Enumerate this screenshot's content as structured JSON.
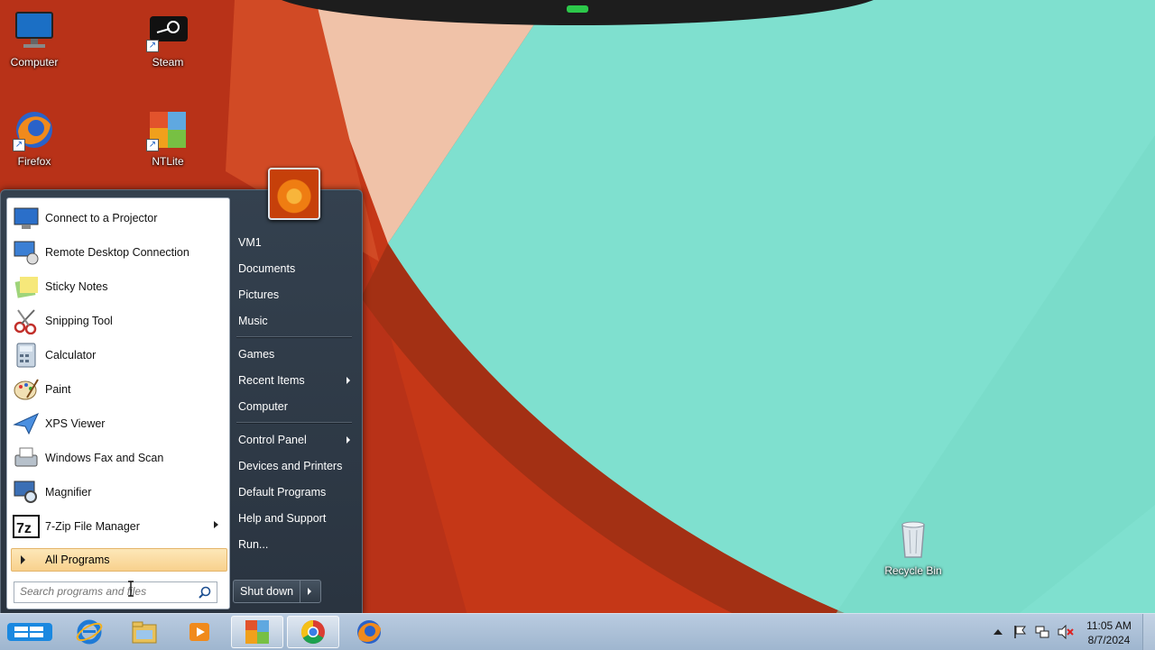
{
  "desktop": {
    "icons": [
      {
        "label": "Computer"
      },
      {
        "label": "Steam"
      },
      {
        "label": "Firefox"
      },
      {
        "label": "NTLite"
      },
      {
        "label": "Recycle Bin"
      }
    ]
  },
  "start_menu": {
    "programs": [
      {
        "label": "Connect to a Projector",
        "icon": "projector-icon"
      },
      {
        "label": "Remote Desktop Connection",
        "icon": "remote-desktop-icon"
      },
      {
        "label": "Sticky Notes",
        "icon": "sticky-notes-icon"
      },
      {
        "label": "Snipping Tool",
        "icon": "scissors-icon"
      },
      {
        "label": "Calculator",
        "icon": "calculator-icon"
      },
      {
        "label": "Paint",
        "icon": "paint-palette-icon"
      },
      {
        "label": "XPS Viewer",
        "icon": "paper-plane-icon"
      },
      {
        "label": "Windows Fax and Scan",
        "icon": "fax-icon"
      },
      {
        "label": "Magnifier",
        "icon": "magnifier-icon"
      },
      {
        "label": "7-Zip File Manager",
        "icon": "7zip-icon",
        "has_submenu": true
      }
    ],
    "all_programs": "All Programs",
    "search_placeholder": "Search programs and files",
    "right_items": [
      {
        "label": "VM1"
      },
      {
        "label": "Documents"
      },
      {
        "label": "Pictures"
      },
      {
        "label": "Music"
      },
      {
        "label": "Games"
      },
      {
        "label": "Recent Items",
        "has_submenu": true
      },
      {
        "label": "Computer"
      },
      {
        "label": "Control Panel",
        "has_submenu": true
      },
      {
        "label": "Devices and Printers"
      },
      {
        "label": "Default Programs"
      },
      {
        "label": "Help and Support"
      },
      {
        "label": "Run..."
      }
    ],
    "shutdown_label": "Shut down"
  },
  "taskbar": {
    "pinned": [
      "internet-explorer-icon",
      "file-explorer-icon",
      "media-player-icon",
      "ntlite-icon",
      "chrome-icon",
      "firefox-icon"
    ],
    "clock_time": "11:05 AM",
    "clock_date": "8/7/2024"
  },
  "colors": {
    "wallpaper_red": "#c9381a",
    "wallpaper_teal": "#7fe0cf",
    "wallpaper_peach": "#f0c2a8",
    "menu_dark": "#2f3b48",
    "highlight": "#fbdca0"
  }
}
